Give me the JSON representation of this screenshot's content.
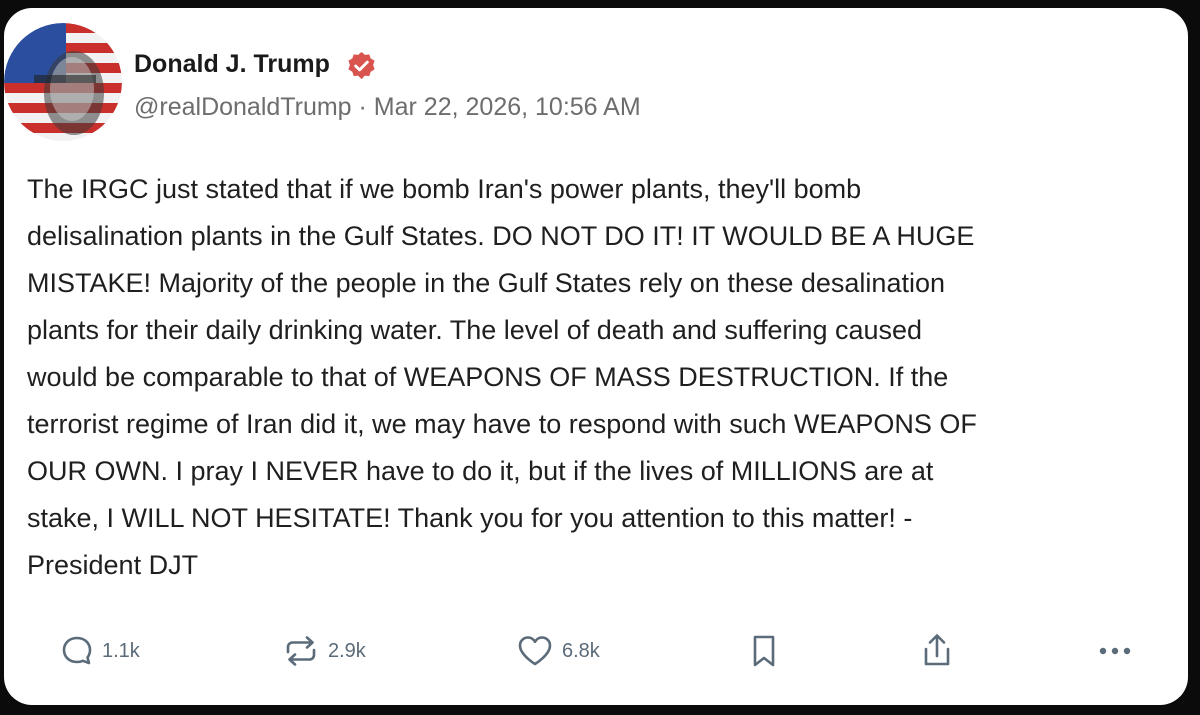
{
  "post": {
    "author": {
      "display_name": "Donald J. Trump",
      "verified": true,
      "meta": "@realDonaldTrump · Mar 22, 2026, 10:56 AM"
    },
    "body_lines": [
      "The IRGC just stated that if we bomb Iran's power plants, they'll bomb",
      "delisalination plants in the Gulf States. DO NOT DO IT! IT WOULD BE A HUGE",
      "MISTAKE! Majority of the people in the Gulf States rely on these desalination",
      "plants for their daily drinking water. The level of death and suffering caused",
      "would be comparable to that of WEAPONS OF MASS DESTRUCTION. If the",
      "terrorist regime of Iran did it, we may have to respond with such WEAPONS OF",
      "OUR OWN. I pray I NEVER have to do it, but if the lives of MILLIONS are at",
      "stake, I WILL NOT HESITATE! Thank you for you attention to this matter! -",
      "President DJT"
    ],
    "actions": {
      "replies": "1.1k",
      "reposts": "2.9k",
      "likes": "6.8k"
    }
  },
  "colors": {
    "verified_badge": "#d9534f",
    "icon_gray": "#5b6b79",
    "meta_gray": "#6d6d6d"
  },
  "icons": {
    "reply": "speech-bubble-icon",
    "repost": "repost-arrows-icon",
    "like": "heart-icon",
    "bookmark": "bookmark-icon",
    "share": "share-icon",
    "more": "more-dots-icon"
  }
}
